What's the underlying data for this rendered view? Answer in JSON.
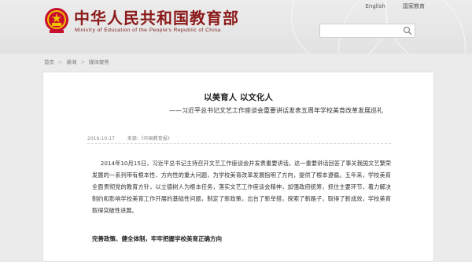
{
  "header": {
    "site_title": "中华人民共和国教育部",
    "site_subtitle": "Ministry of Education of the People's Republic of China",
    "top_links": [
      "English",
      "国家教育"
    ],
    "search_placeholder": ""
  },
  "breadcrumb": {
    "items": [
      "首页",
      "新闻",
      "媒体聚焦"
    ]
  },
  "article": {
    "title": "以美育人 以文化人",
    "subtitle": "——习近平总书记文艺工作座谈会重要讲话发表五周年学校美育改革发展巡礼",
    "date": "2019-10-17",
    "source": "来源：《中国教育报》",
    "paragraph": "2014年10月15日，习近平总书记主持召开文艺工作座谈会并发表重要讲话。这一重要讲话回答了事关我国文艺繁荣发展的一系列带有根本性、方向性的重大问题，为学校美育改革发展指明了方向，提供了根本遵循。五年来，学校美育全面贯彻党的教育方针，以立德树人为根本任务，落实文艺工作座谈会精神，加强政府统筹，抓住主要环节，着力解决制约和影响学校美育工作开展的基础性问题，制定了新政策，出台了新举措，探索了新路子，取得了新成效，学校美育取得突破性进展。",
    "section_heading": "完善政策、健全体制，牢牢把握学校美育正确方向"
  },
  "colors": {
    "brand_red": "#8c1a1a",
    "page_bg": "#ebebeb",
    "content_bg": "#ffffff"
  }
}
